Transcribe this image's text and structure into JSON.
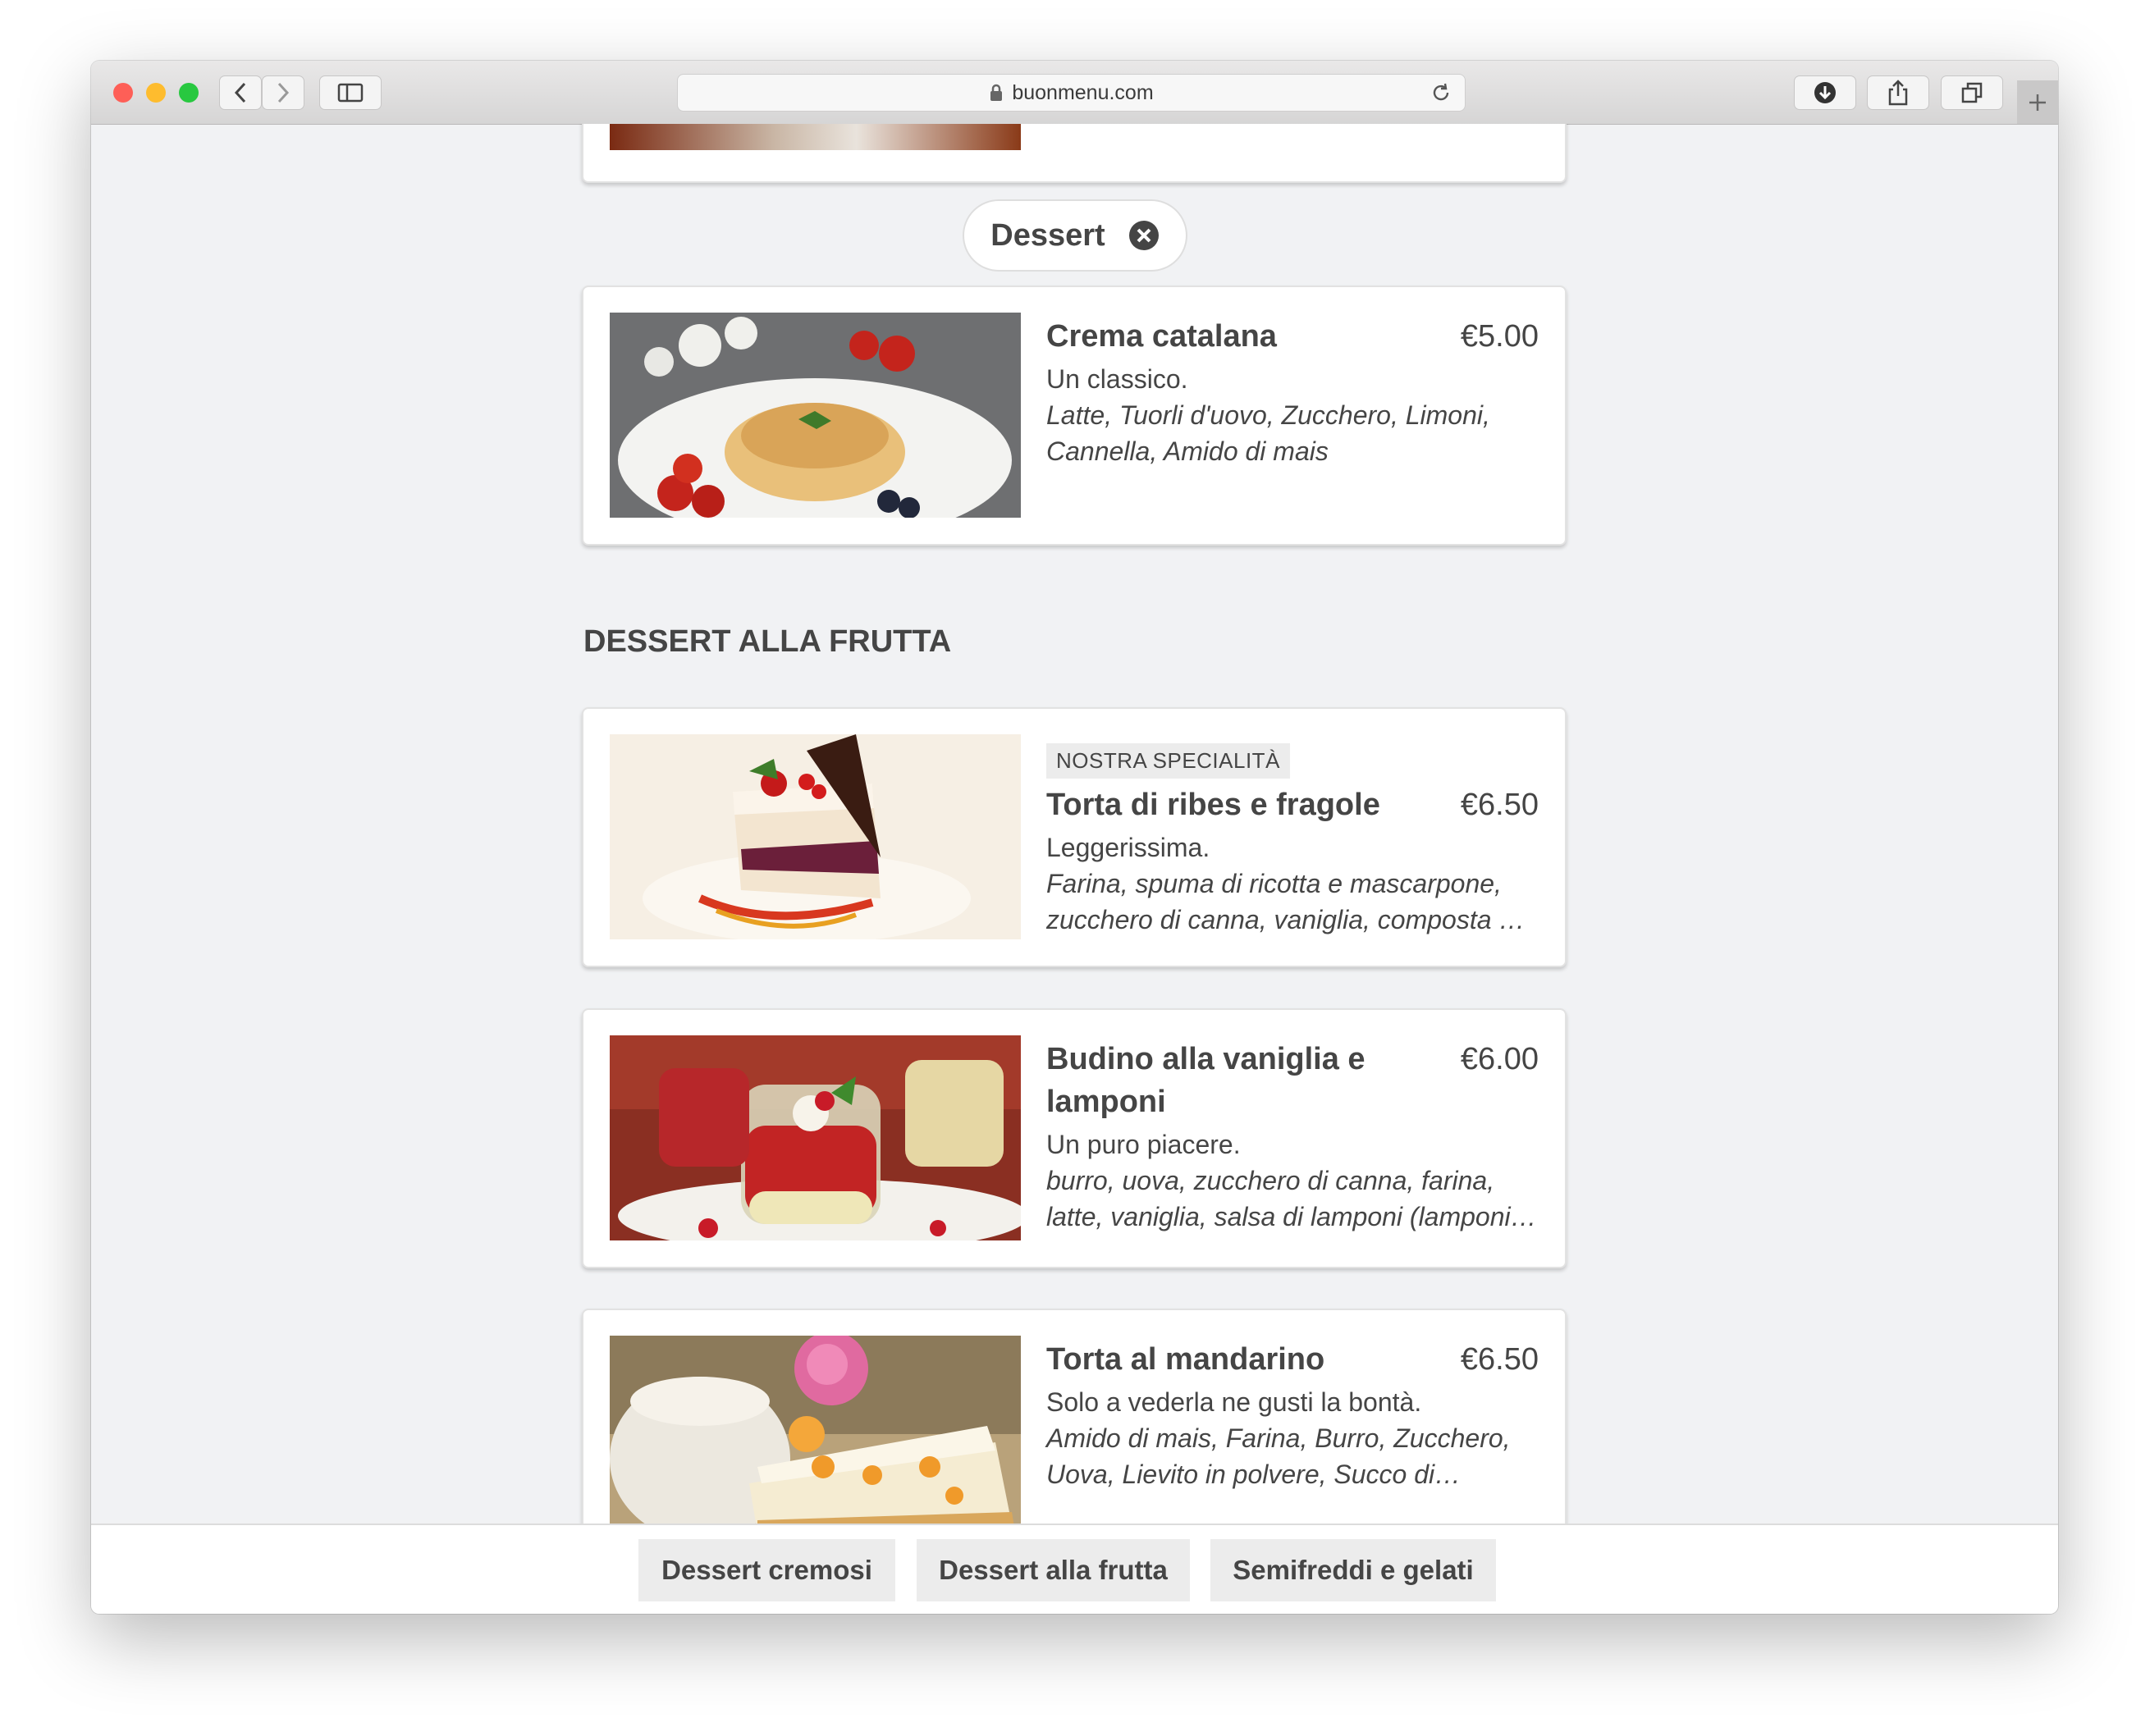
{
  "browser": {
    "url": "buonmenu.com",
    "traffic_lights": {
      "close": "#fe5f57",
      "minimize": "#febc2e",
      "zoom": "#28c840"
    }
  },
  "category_pill": {
    "label": "Dessert"
  },
  "section": {
    "title": "DESSERT ALLA FRUTTA"
  },
  "items": [
    {
      "name": "Crema catalana",
      "price": "€5.00",
      "description": "Un classico.",
      "ingredients": "Latte, Tuorli d'uovo, Zucchero, Limoni, Cannella, Amido di mais"
    },
    {
      "badge": "NOSTRA SPECIALITÀ",
      "name": "Torta di ribes e fragole",
      "price": "€6.50",
      "description": "Leggerissima.",
      "ingredients": "Farina, spuma di ricotta e mascarpone, zucchero di canna, vaniglia, composta …"
    },
    {
      "name": "Budino alla vaniglia e lamponi",
      "price": "€6.00",
      "description": "Un puro piacere.",
      "ingredients": "burro, uova, zucchero di canna, farina, latte, vaniglia, salsa di lamponi (lamponi…"
    },
    {
      "name": "Torta al mandarino",
      "price": "€6.50",
      "description": "Solo a vederla ne gusti la bontà.",
      "ingredients": "Amido di mais, Farina, Burro, Zucchero, Uova, Lievito in polvere, Succo di…"
    }
  ],
  "bottom_tabs": [
    "Dessert cremosi",
    "Dessert alla frutta",
    "Semifreddi e gelati"
  ]
}
